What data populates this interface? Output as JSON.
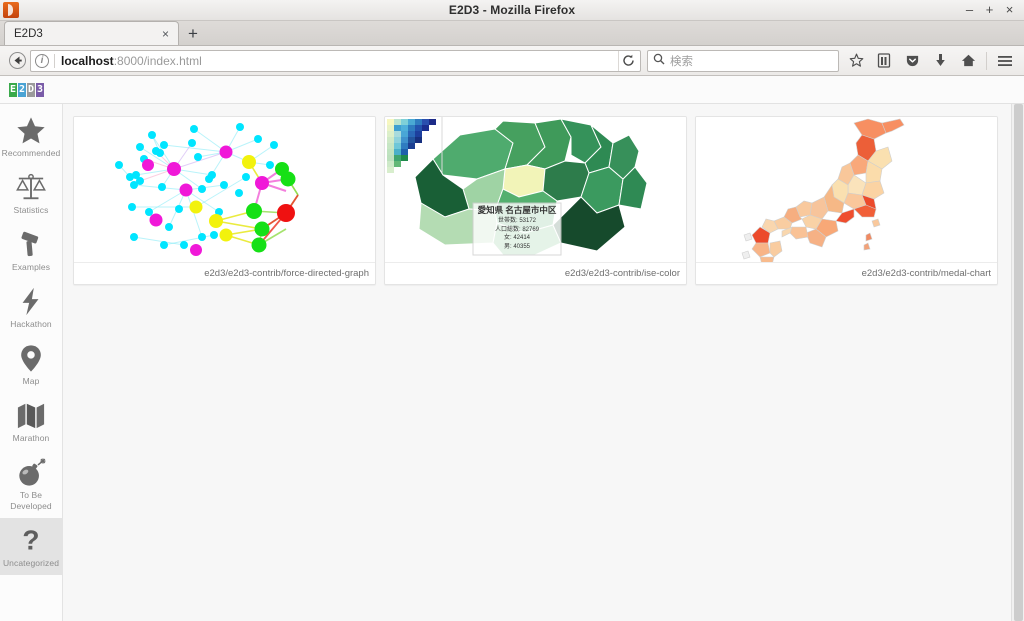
{
  "window": {
    "title": "E2D3 - Mozilla Firefox",
    "app_icon": "firefox-icon",
    "minimize": "–",
    "maximize": "+",
    "close": "×"
  },
  "tabs": {
    "items": [
      {
        "label": "E2D3",
        "close": "×"
      }
    ],
    "new_tab": "+"
  },
  "navbar": {
    "back_icon": "back-arrow-icon",
    "identity_icon": "info-icon",
    "url_host": "localhost",
    "url_path": ":8000/index.html",
    "reload_icon": "reload-icon",
    "search_icon": "search-icon",
    "search_placeholder": "検索",
    "icons": [
      {
        "name": "bookmark-star-icon",
        "glyph": "☆"
      },
      {
        "name": "library-icon",
        "glyph": "▤"
      },
      {
        "name": "pocket-icon",
        "glyph": "▽"
      },
      {
        "name": "downloads-icon",
        "glyph": "⬇"
      },
      {
        "name": "home-icon",
        "glyph": "⌂"
      },
      {
        "name": "menu-hamburger-icon",
        "glyph": "☰"
      }
    ]
  },
  "page": {
    "logo": {
      "name": "e2d3-logo",
      "chars": [
        {
          "ch": "E",
          "bg": "#3aa94b",
          "fg": "#ffffff"
        },
        {
          "ch": "2",
          "bg": "#4aa3d4",
          "fg": "#ffffff"
        },
        {
          "ch": "D",
          "bg": "#9b9b9b",
          "fg": "#ffffff"
        },
        {
          "ch": "3",
          "bg": "#7a5ca8",
          "fg": "#ffffff"
        }
      ]
    }
  },
  "sidebar": {
    "items": [
      {
        "label": "Recommended",
        "icon": "star-icon",
        "active": false
      },
      {
        "label": "Statistics",
        "icon": "scales-icon",
        "active": false
      },
      {
        "label": "Examples",
        "icon": "hammer-icon",
        "active": false
      },
      {
        "label": "Hackathon",
        "icon": "lightning-bolt-icon",
        "active": false
      },
      {
        "label": "Map",
        "icon": "map-pin-icon",
        "active": false
      },
      {
        "label": "Marathon",
        "icon": "folded-map-icon",
        "active": false
      },
      {
        "label": "To Be Developed",
        "icon": "bomb-icon",
        "active": false
      },
      {
        "label": "Uncategorized",
        "icon": "question-mark-icon",
        "active": true
      }
    ]
  },
  "gallery": {
    "cards": [
      {
        "caption": "e2d3/e2d3-contrib/force-directed-graph",
        "figure": "force-directed-graph"
      },
      {
        "caption": "e2d3/e2d3-contrib/ise-color",
        "figure": "choropleth-green-map",
        "tooltip": {
          "title": "愛知県 名古屋市中区",
          "rows": [
            {
              "label": "世帯数",
              "value": "53172"
            },
            {
              "label": "人口総数",
              "value": "82769"
            },
            {
              "label": "女",
              "value": "42414"
            },
            {
              "label": "男",
              "value": "40355"
            }
          ]
        }
      },
      {
        "caption": "e2d3/e2d3-contrib/medal-chart",
        "figure": "japan-choropleth-orange"
      }
    ]
  }
}
